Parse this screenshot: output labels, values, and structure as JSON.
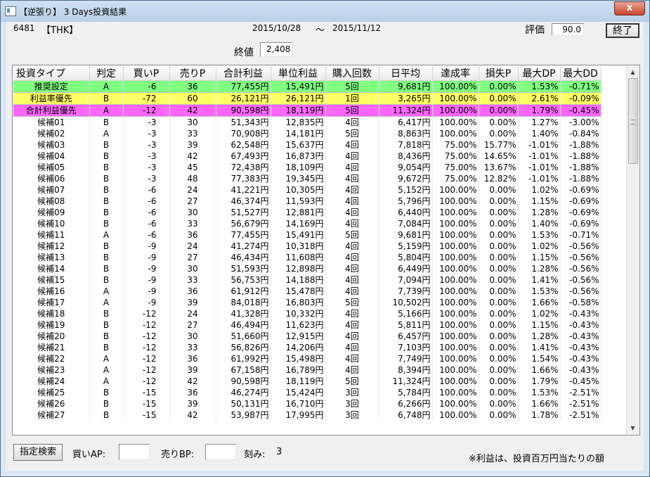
{
  "window": {
    "title": "【逆張り】 3 Days投資結果",
    "close_label": "x"
  },
  "header": {
    "code": "6481",
    "ticker": "【THK】",
    "period_start": "2015/10/28",
    "period_sep": "～",
    "period_end": "2015/11/12",
    "rating_label": "評価",
    "rating_value": "90.0",
    "end_button": "終了",
    "close_price_label": "終値",
    "close_price_value": "2,408"
  },
  "table": {
    "columns": [
      "投資タイプ",
      "判定",
      "買いP",
      "売りP",
      "合計利益",
      "単位利益",
      "購入回数",
      "日平均",
      "達成率",
      "損失P",
      "最大DP",
      "最大DD"
    ],
    "highlight_colors": [
      "#80ff80",
      "#ffff66",
      "#ff66ff"
    ],
    "rows": [
      [
        "推奨設定",
        "A",
        "-6",
        "36",
        "77,455円",
        "15,491円",
        "5回",
        "9,681円",
        "100.00%",
        "0.00%",
        "1.53%",
        "-0.71%"
      ],
      [
        "利益率優先",
        "B",
        "-72",
        "60",
        "26,121円",
        "26,121円",
        "1回",
        "3,265円",
        "100.00%",
        "0.00%",
        "2.61%",
        "-0.09%"
      ],
      [
        "合計利益優先",
        "A",
        "-12",
        "42",
        "90,598円",
        "18,119円",
        "5回",
        "11,324円",
        "100.00%",
        "0.00%",
        "1.79%",
        "-0.45%"
      ],
      [
        "候補01",
        "B",
        "-3",
        "30",
        "51,343円",
        "12,835円",
        "4回",
        "6,417円",
        "100.00%",
        "0.00%",
        "1.27%",
        "-3.00%"
      ],
      [
        "候補02",
        "A",
        "-3",
        "33",
        "70,908円",
        "14,181円",
        "5回",
        "8,863円",
        "100.00%",
        "0.00%",
        "1.40%",
        "-0.84%"
      ],
      [
        "候補03",
        "B",
        "-3",
        "39",
        "62,548円",
        "15,637円",
        "4回",
        "7,818円",
        "75.00%",
        "15.77%",
        "-1.01%",
        "-1.88%"
      ],
      [
        "候補04",
        "B",
        "-3",
        "42",
        "67,493円",
        "16,873円",
        "4回",
        "8,436円",
        "75.00%",
        "14.65%",
        "-1.01%",
        "-1.88%"
      ],
      [
        "候補05",
        "B",
        "-3",
        "45",
        "72,438円",
        "18,109円",
        "4回",
        "9,054円",
        "75.00%",
        "13.67%",
        "-1.01%",
        "-1.88%"
      ],
      [
        "候補06",
        "B",
        "-3",
        "48",
        "77,383円",
        "19,345円",
        "4回",
        "9,672円",
        "75.00%",
        "12.82%",
        "-1.01%",
        "-1.88%"
      ],
      [
        "候補07",
        "B",
        "-6",
        "24",
        "41,221円",
        "10,305円",
        "4回",
        "5,152円",
        "100.00%",
        "0.00%",
        "1.02%",
        "-0.69%"
      ],
      [
        "候補08",
        "B",
        "-6",
        "27",
        "46,374円",
        "11,593円",
        "4回",
        "5,796円",
        "100.00%",
        "0.00%",
        "1.15%",
        "-0.69%"
      ],
      [
        "候補09",
        "B",
        "-6",
        "30",
        "51,527円",
        "12,881円",
        "4回",
        "6,440円",
        "100.00%",
        "0.00%",
        "1.28%",
        "-0.69%"
      ],
      [
        "候補10",
        "B",
        "-6",
        "33",
        "56,679円",
        "14,169円",
        "4回",
        "7,084円",
        "100.00%",
        "0.00%",
        "1.40%",
        "-0.69%"
      ],
      [
        "候補11",
        "A",
        "-6",
        "36",
        "77,455円",
        "15,491円",
        "5回",
        "9,681円",
        "100.00%",
        "0.00%",
        "1.53%",
        "-0.71%"
      ],
      [
        "候補12",
        "B",
        "-9",
        "24",
        "41,274円",
        "10,318円",
        "4回",
        "5,159円",
        "100.00%",
        "0.00%",
        "1.02%",
        "-0.56%"
      ],
      [
        "候補13",
        "B",
        "-9",
        "27",
        "46,434円",
        "11,608円",
        "4回",
        "5,804円",
        "100.00%",
        "0.00%",
        "1.15%",
        "-0.56%"
      ],
      [
        "候補14",
        "B",
        "-9",
        "30",
        "51,593円",
        "12,898円",
        "4回",
        "6,449円",
        "100.00%",
        "0.00%",
        "1.28%",
        "-0.56%"
      ],
      [
        "候補15",
        "B",
        "-9",
        "33",
        "56,753円",
        "14,188円",
        "4回",
        "7,094円",
        "100.00%",
        "0.00%",
        "1.41%",
        "-0.56%"
      ],
      [
        "候補16",
        "A",
        "-9",
        "36",
        "61,912円",
        "15,478円",
        "4回",
        "7,739円",
        "100.00%",
        "0.00%",
        "1.53%",
        "-0.56%"
      ],
      [
        "候補17",
        "A",
        "-9",
        "39",
        "84,018円",
        "16,803円",
        "5回",
        "10,502円",
        "100.00%",
        "0.00%",
        "1.66%",
        "-0.58%"
      ],
      [
        "候補18",
        "B",
        "-12",
        "24",
        "41,328円",
        "10,332円",
        "4回",
        "5,166円",
        "100.00%",
        "0.00%",
        "1.02%",
        "-0.43%"
      ],
      [
        "候補19",
        "B",
        "-12",
        "27",
        "46,494円",
        "11,623円",
        "4回",
        "5,811円",
        "100.00%",
        "0.00%",
        "1.15%",
        "-0.43%"
      ],
      [
        "候補20",
        "B",
        "-12",
        "30",
        "51,660円",
        "12,915円",
        "4回",
        "6,457円",
        "100.00%",
        "0.00%",
        "1.28%",
        "-0.43%"
      ],
      [
        "候補21",
        "B",
        "-12",
        "33",
        "56,826円",
        "14,206円",
        "4回",
        "7,103円",
        "100.00%",
        "0.00%",
        "1.41%",
        "-0.43%"
      ],
      [
        "候補22",
        "A",
        "-12",
        "36",
        "61,992円",
        "15,498円",
        "4回",
        "7,749円",
        "100.00%",
        "0.00%",
        "1.54%",
        "-0.43%"
      ],
      [
        "候補23",
        "A",
        "-12",
        "39",
        "67,158円",
        "16,789円",
        "4回",
        "8,394円",
        "100.00%",
        "0.00%",
        "1.66%",
        "-0.43%"
      ],
      [
        "候補24",
        "A",
        "-12",
        "42",
        "90,598円",
        "18,119円",
        "5回",
        "11,324円",
        "100.00%",
        "0.00%",
        "1.79%",
        "-0.45%"
      ],
      [
        "候補25",
        "B",
        "-15",
        "36",
        "46,274円",
        "15,424円",
        "3回",
        "5,784円",
        "100.00%",
        "0.00%",
        "1.53%",
        "-2.51%"
      ],
      [
        "候補26",
        "B",
        "-15",
        "39",
        "50,131円",
        "16,710円",
        "3回",
        "6,266円",
        "100.00%",
        "0.00%",
        "1.66%",
        "-2.51%"
      ],
      [
        "候補27",
        "B",
        "-15",
        "42",
        "53,987円",
        "17,995円",
        "3回",
        "6,748円",
        "100.00%",
        "0.00%",
        "1.78%",
        "-2.51%"
      ]
    ]
  },
  "footer": {
    "search_button": "指定検索",
    "buy_ap_label": "買いAP:",
    "sell_bp_label": "売りBP:",
    "step_label": "刻み:",
    "step_value": "3",
    "note": "※利益は、投資百万円当たりの額"
  }
}
